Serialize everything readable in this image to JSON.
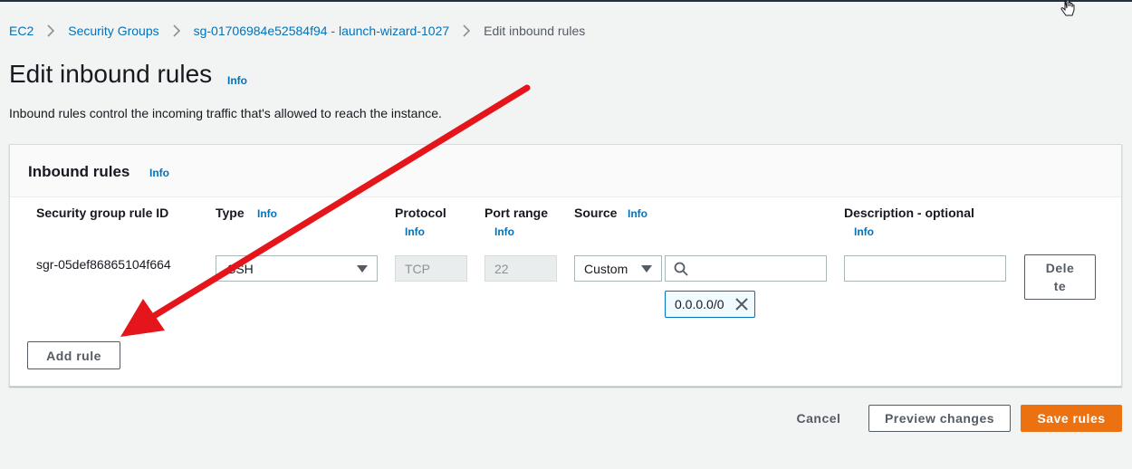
{
  "breadcrumb": {
    "items": [
      "EC2",
      "Security Groups",
      "sg-01706984e52584f94 - launch-wizard-1027"
    ],
    "current": "Edit inbound rules"
  },
  "page": {
    "title": "Edit inbound rules",
    "title_info": "Info",
    "description": "Inbound rules control the incoming traffic that's allowed to reach the instance."
  },
  "panel": {
    "title": "Inbound rules",
    "info": "Info",
    "columns": {
      "rule_id": "Security group rule ID",
      "type": "Type",
      "protocol": "Protocol",
      "port_range": "Port range",
      "source": "Source",
      "description": "Description - optional",
      "info": "Info"
    },
    "row": {
      "rule_id": "sgr-05def86865104f664",
      "type": "SSH",
      "protocol": "TCP",
      "port_range": "22",
      "source_type": "Custom",
      "source_search": "",
      "source_token": "0.0.0.0/0",
      "description": "",
      "delete_label_1": "Dele",
      "delete_label_2": "te"
    },
    "add_rule": "Add rule"
  },
  "footer": {
    "cancel": "Cancel",
    "preview": "Preview changes",
    "save": "Save rules"
  },
  "colors": {
    "link": "#0073bb",
    "primary": "#ec7211",
    "annotation_arrow": "#e4161b"
  }
}
